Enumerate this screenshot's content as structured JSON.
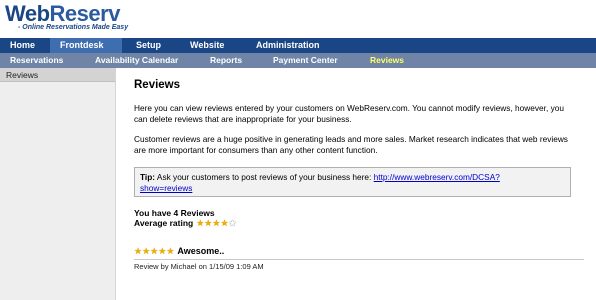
{
  "logo": {
    "brand_part1": "Web",
    "brand_part2": "Reserv",
    "tagline": "- Online Reservations Made Easy"
  },
  "nav_primary": {
    "items": [
      {
        "label": "Home"
      },
      {
        "label": "Frontdesk"
      },
      {
        "label": "Setup"
      },
      {
        "label": "Website"
      },
      {
        "label": "Administration"
      }
    ],
    "active": "Frontdesk"
  },
  "nav_secondary": {
    "items": [
      {
        "label": "Reservations"
      },
      {
        "label": "Availability Calendar"
      },
      {
        "label": "Reports"
      },
      {
        "label": "Payment Center"
      },
      {
        "label": "Reviews"
      }
    ],
    "active": "Reviews"
  },
  "sidebar": {
    "items": [
      {
        "label": "Reviews"
      }
    ]
  },
  "main": {
    "title": "Reviews",
    "para1": "Here you can view reviews entered by your customers on WebReserv.com. You cannot modify reviews, however, you can delete reviews that are inappropriate for your business.",
    "para2": "Customer reviews are a huge positive in generating leads and more sales. Market research indicates that web reviews are more important for consumers than any other content function.",
    "tip": {
      "label": "Tip:",
      "text": " Ask your customers to post reviews of your business here: ",
      "link_line1": "http://www.webreserv.com/DCSA?",
      "link_line2": "show=reviews"
    },
    "summary": {
      "count_text": "You have 4 Reviews",
      "avg_label": "Average rating",
      "avg_stars": 4,
      "max_stars": 5
    },
    "reviews": [
      {
        "title": "Awesome..",
        "stars": 5,
        "meta": "Review by Michael on 1/15/09 1:09 AM"
      }
    ]
  },
  "colors": {
    "nav_primary_bg": "#1b4686",
    "nav_primary_active": "#3f6eb0",
    "nav_secondary_bg": "#6f84a6",
    "nav_secondary_active_text": "#ffff66",
    "link": "#0000cc",
    "star": "#f0b000"
  }
}
